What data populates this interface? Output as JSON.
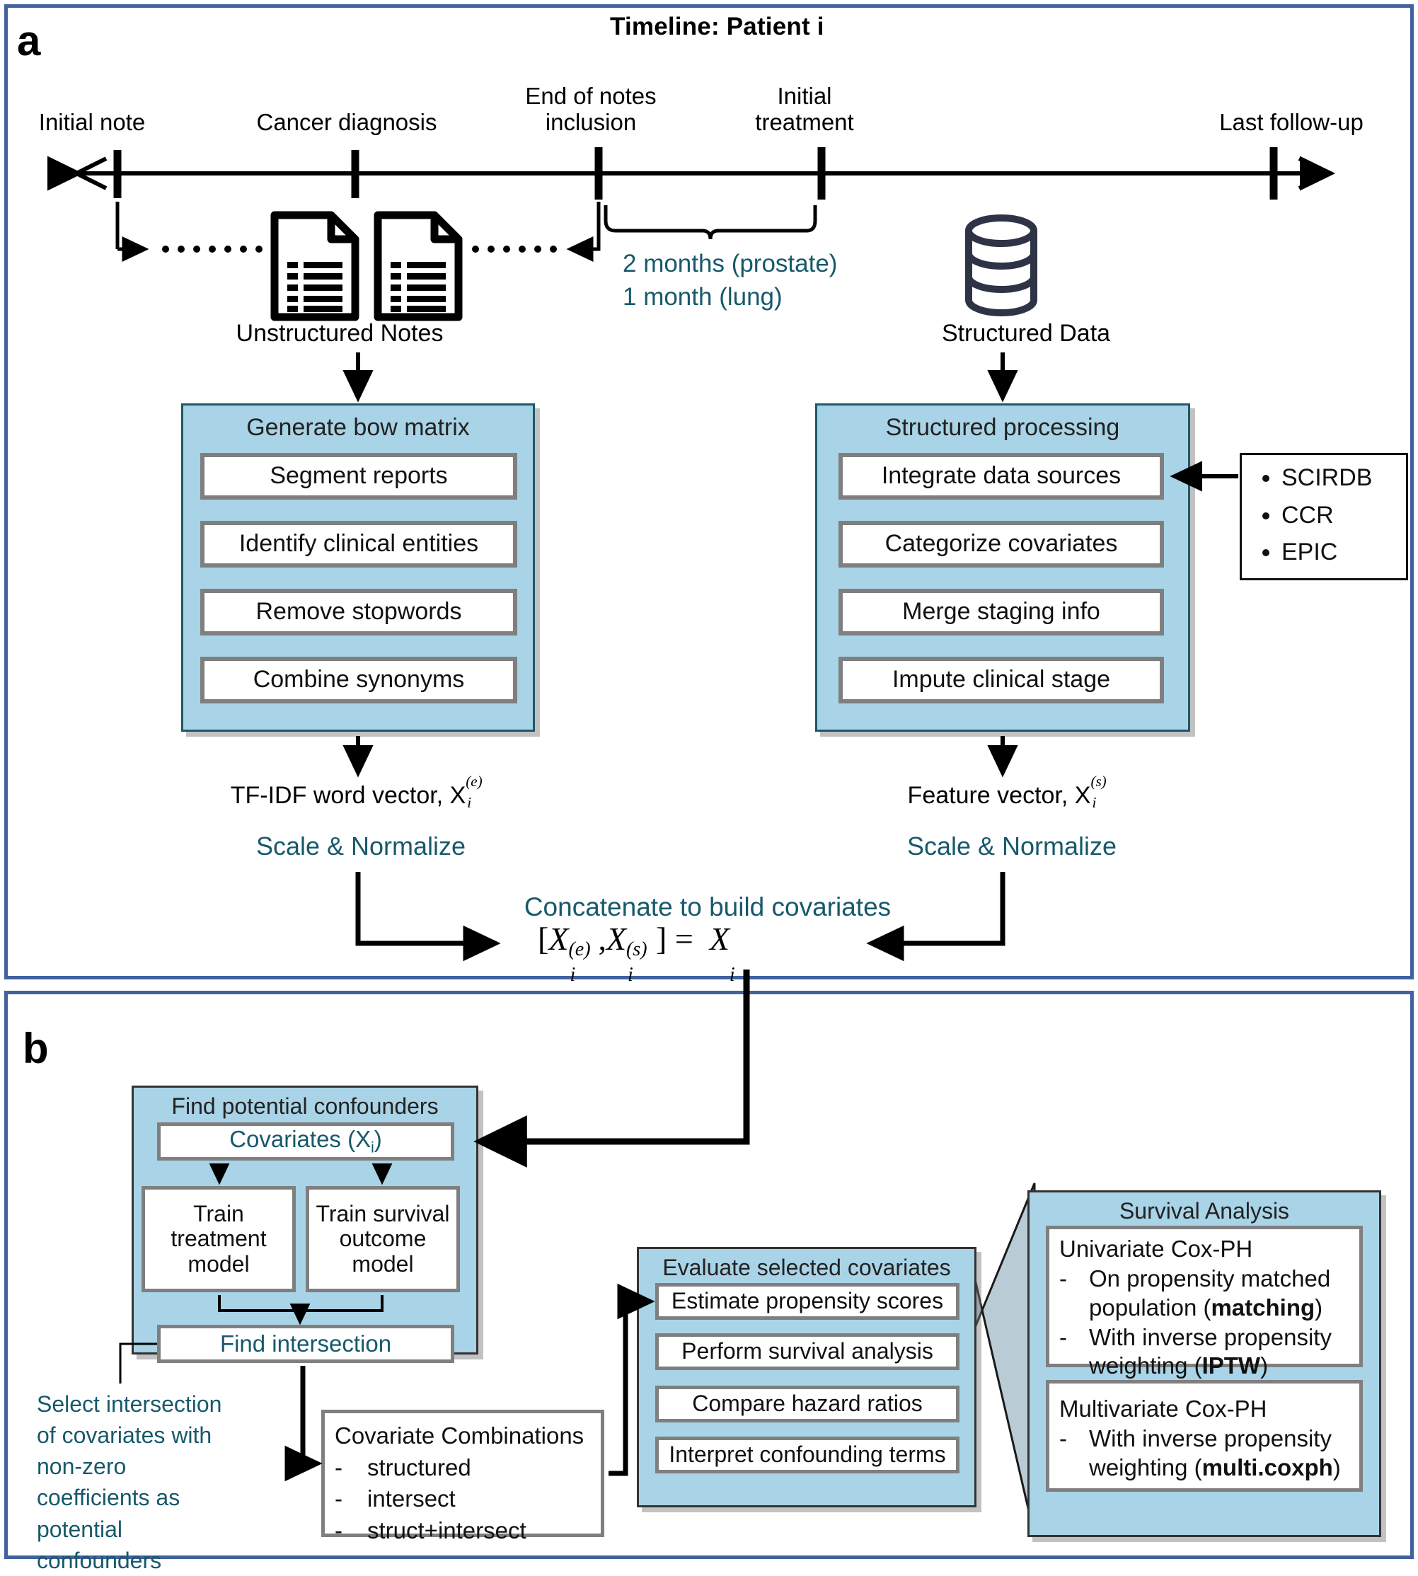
{
  "panel_a": {
    "label": "a",
    "timeline": {
      "title": "Timeline: Patient i",
      "ticks": [
        {
          "label": "Initial note"
        },
        {
          "label": "Cancer diagnosis"
        },
        {
          "label": "End of notes\ninclusion"
        },
        {
          "label": "Initial\ntreatment"
        },
        {
          "label": "Last follow-up"
        }
      ],
      "bracket_note_line1": "2 months (prostate)",
      "bracket_note_line2": "1 month   (lung)"
    },
    "unstructured_caption": "Unstructured Notes",
    "structured_caption": "Structured Data",
    "bow_box": {
      "title": "Generate bow matrix",
      "steps": [
        "Segment reports",
        "Identify clinical entities",
        "Remove stopwords",
        "Combine synonyms"
      ]
    },
    "structured_box": {
      "title": "Structured processing",
      "steps": [
        "Integrate data sources",
        "Categorize covariates",
        "Merge staging info",
        "Impute clinical stage"
      ]
    },
    "sources_box": {
      "items": [
        "SCIRDB",
        "CCR",
        "EPIC"
      ]
    },
    "tfidf_label": "TF-IDF word vector, X",
    "tfidf_sup": "(e)",
    "tfidf_sub": "i",
    "feature_label": "Feature vector, X",
    "feature_sup": "(s)",
    "feature_sub": "i",
    "scale_normalize_left": "Scale & Normalize",
    "scale_normalize_right": "Scale & Normalize",
    "concatenate_label": "Concatenate to build covariates",
    "concat_formula": "[X(e)i , X(s)i ] =  Xi"
  },
  "panel_b": {
    "label": "b",
    "confounders_box": {
      "title": "Find potential confounders",
      "covariates_label": "Covariates (X",
      "covariates_sub": "i",
      "covariates_close": ")",
      "train_treatment": "Train\ntreatment\nmodel",
      "train_survival": "Train survival\noutcome\nmodel",
      "find_intersection": "Find intersection"
    },
    "annotation": "Select intersection of covariates with non-zero coefficients as potential confounders",
    "covariate_combinations": {
      "title": "Covariate Combinations",
      "items": [
        "structured",
        "intersect",
        "struct+intersect"
      ]
    },
    "evaluate_box": {
      "title": "Evaluate selected covariates",
      "steps": [
        "Estimate propensity scores",
        "Perform survival analysis",
        "Compare hazard ratios",
        "Interpret confounding terms"
      ]
    },
    "survival_box": {
      "title": "Survival Analysis",
      "univariate": {
        "heading": "Univariate Cox-PH",
        "items": [
          {
            "text": "On propensity matched population (",
            "bold": "matching",
            "tail": ")"
          },
          {
            "text": "With inverse propensity weighting (",
            "bold": "IPTW",
            "tail": ")"
          }
        ]
      },
      "multivariate": {
        "heading": "Multivariate Cox-PH",
        "items": [
          {
            "text": "With inverse propensity weighting (",
            "bold": "multi.coxph",
            "tail": ")"
          }
        ]
      }
    }
  },
  "colors": {
    "panel_border": "#41629f",
    "box_fill": "#a9d3e6",
    "box_border": "#1d5868",
    "teal_text": "#17596b",
    "inner_box_border": "#7f7f7f",
    "icon_dark": "#2e3446"
  },
  "icons": {
    "document": "document-icon",
    "database": "database-icon"
  }
}
